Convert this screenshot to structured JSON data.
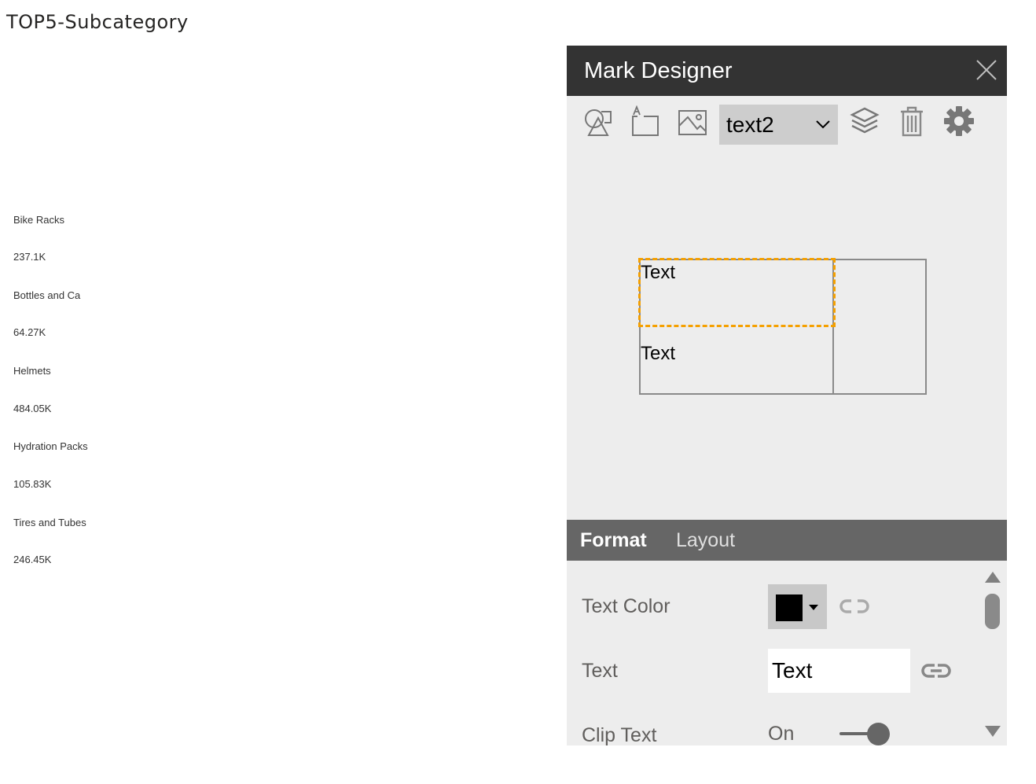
{
  "visual": {
    "title": "TOP5-Subcategory",
    "items": [
      {
        "label": "Bike Racks",
        "value": "237.1K"
      },
      {
        "label": "Bottles and Ca",
        "value": "64.27K"
      },
      {
        "label": "Helmets",
        "value": "484.05K"
      },
      {
        "label": "Hydration Packs",
        "value": "105.83K"
      },
      {
        "label": "Tires and Tubes",
        "value": "246.45K"
      }
    ]
  },
  "designer": {
    "title": "Mark Designer",
    "toolbar": {
      "icons": [
        "shapes-icon",
        "text-box-icon",
        "image-icon",
        "layers-icon",
        "delete-icon",
        "settings-icon"
      ],
      "selected_mark": "text2"
    },
    "canvas": {
      "mark1_text": "Text",
      "mark2_text": "Text",
      "selection_color": "#f5a000"
    },
    "tabs": {
      "format_label": "Format",
      "layout_label": "Layout",
      "active": "Format"
    },
    "properties": {
      "text_color_label": "Text Color",
      "text_color_value": "#000000",
      "text_label": "Text",
      "text_value": "Text",
      "clip_text_label": "Clip Text",
      "clip_text_state": "On"
    }
  }
}
